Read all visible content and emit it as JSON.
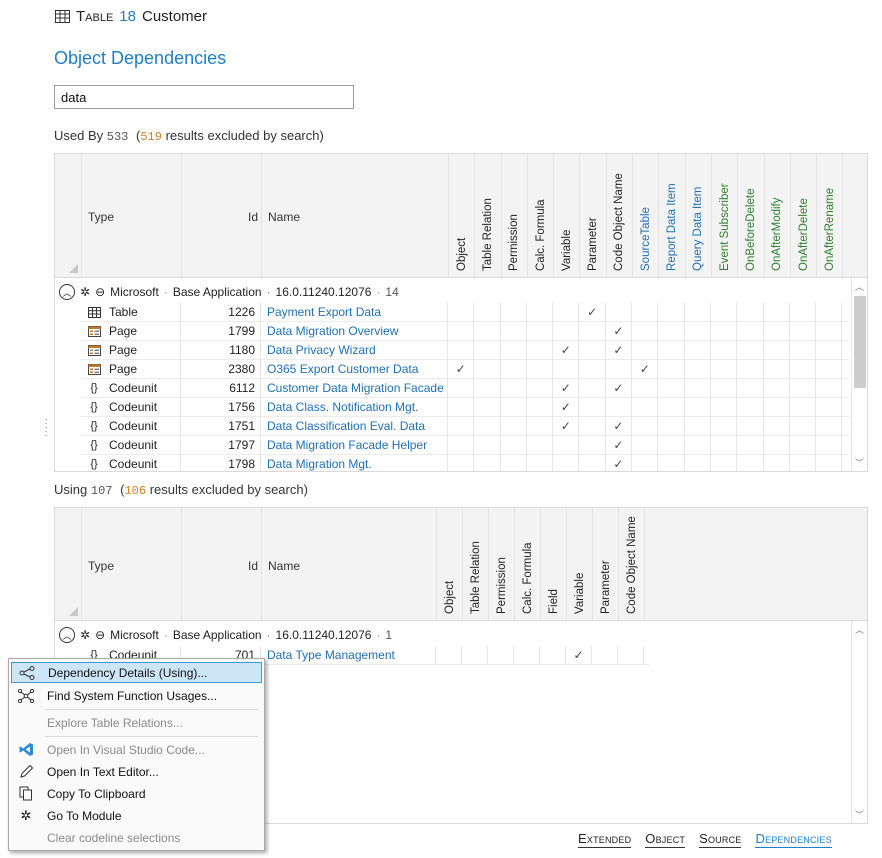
{
  "header": {
    "object_type": "Table",
    "object_id": "18",
    "object_name": "Customer"
  },
  "page_title": "Object Dependencies",
  "search": {
    "value": "data"
  },
  "used_by": {
    "label": "Used By",
    "count": "533",
    "excluded_open": "(",
    "excluded_count": "519",
    "excluded_text": "results excluded by search)",
    "col_type": "Type",
    "col_id": "Id",
    "col_name": "Name",
    "columns": [
      "Object",
      "Table Relation",
      "Permission",
      "Calc. Formula",
      "Variable",
      "Parameter",
      "Code Object Name",
      "SourceTable",
      "Report Data Item",
      "Query Data Item",
      "Event Subscriber",
      "OnBeforeDelete",
      "OnAfterModify",
      "OnAfterDelete",
      "OnAfterRename"
    ],
    "column_colors": [
      "#222222",
      "#222222",
      "#222222",
      "#222222",
      "#222222",
      "#222222",
      "#222222",
      "#1f6fb8",
      "#1f6fb8",
      "#1f6fb8",
      "#2e7d32",
      "#2e7d32",
      "#2e7d32",
      "#2e7d32",
      "#2e7d32"
    ],
    "group": {
      "publisher": "Microsoft",
      "app": "Base Application",
      "version": "16.0.11240.12076",
      "count": "14",
      "sep1": "·",
      "sep2": "·",
      "sep3": "·"
    },
    "rows": [
      {
        "type": "Table",
        "icon": "table-icon",
        "id": "1226",
        "name": "Payment Export Data",
        "checks": [
          5
        ]
      },
      {
        "type": "Page",
        "icon": "page-icon",
        "id": "1799",
        "name": "Data Migration Overview",
        "checks": [
          6
        ]
      },
      {
        "type": "Page",
        "icon": "page-icon",
        "id": "1180",
        "name": "Data Privacy Wizard",
        "checks": [
          4,
          6
        ]
      },
      {
        "type": "Page",
        "icon": "page-icon",
        "id": "2380",
        "name": "O365 Export Customer Data",
        "checks": [
          0,
          7
        ]
      },
      {
        "type": "Codeunit",
        "icon": "codeunit-icon",
        "id": "6112",
        "name": "Customer Data Migration Facade",
        "checks": [
          4,
          6
        ]
      },
      {
        "type": "Codeunit",
        "icon": "codeunit-icon",
        "id": "1756",
        "name": "Data Class. Notification Mgt.",
        "checks": [
          4
        ]
      },
      {
        "type": "Codeunit",
        "icon": "codeunit-icon",
        "id": "1751",
        "name": "Data Classification Eval. Data",
        "checks": [
          4,
          6
        ]
      },
      {
        "type": "Codeunit",
        "icon": "codeunit-icon",
        "id": "1797",
        "name": "Data Migration Facade Helper",
        "checks": [
          6
        ]
      },
      {
        "type": "Codeunit",
        "icon": "codeunit-icon",
        "id": "1798",
        "name": "Data Migration Mgt.",
        "checks": [
          6
        ]
      }
    ]
  },
  "using": {
    "label": "Using",
    "count": "107",
    "excluded_open": "(",
    "excluded_count": "106",
    "excluded_text": "results excluded by search)",
    "col_type": "Type",
    "col_id": "Id",
    "col_name": "Name",
    "columns": [
      "Object",
      "Table Relation",
      "Permission",
      "Calc. Formula",
      "Field",
      "Variable",
      "Parameter",
      "Code Object Name"
    ],
    "group": {
      "publisher": "Microsoft",
      "app": "Base Application",
      "version": "16.0.11240.12076",
      "count": "1",
      "sep1": "·",
      "sep2": "·",
      "sep3": "·"
    },
    "rows": [
      {
        "type": "Codeunit",
        "icon": "codeunit-icon",
        "id": "701",
        "name": "Data Type Management",
        "checks": [
          5
        ]
      }
    ]
  },
  "context_menu": {
    "items": [
      {
        "label": "Dependency Details (Using)...",
        "icon": "share-icon",
        "enabled": true,
        "selected": true
      },
      {
        "label": "Find System Function Usages...",
        "icon": "network-icon",
        "enabled": true
      },
      {
        "label": "Explore Table Relations...",
        "icon": "",
        "enabled": false
      },
      {
        "label": "Open In Visual Studio Code...",
        "icon": "vscode-icon",
        "enabled": false
      },
      {
        "label": "Open In Text Editor...",
        "icon": "pencil-icon",
        "enabled": true
      },
      {
        "label": "Copy To Clipboard",
        "icon": "copy-icon",
        "enabled": true
      },
      {
        "label": "Go To Module",
        "icon": "puzzle-icon",
        "enabled": true
      },
      {
        "label": "Clear codeline selections",
        "icon": "",
        "enabled": false
      }
    ]
  },
  "bottom_tabs": [
    {
      "label": "Extended",
      "active": false
    },
    {
      "label": "Object",
      "active": false
    },
    {
      "label": "Source",
      "active": false
    },
    {
      "label": "Dependencies",
      "active": true
    }
  ]
}
